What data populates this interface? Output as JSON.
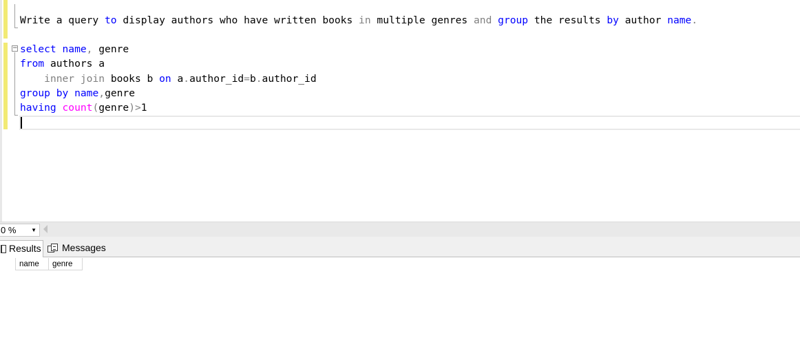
{
  "editor": {
    "comment_line": [
      {
        "t": "Write a query ",
        "c": ""
      },
      {
        "t": "to",
        "c": "kw"
      },
      {
        "t": " display authors who have written books ",
        "c": ""
      },
      {
        "t": "in",
        "c": "gr"
      },
      {
        "t": " multiple genres ",
        "c": ""
      },
      {
        "t": "and",
        "c": "gr"
      },
      {
        "t": " ",
        "c": ""
      },
      {
        "t": "group",
        "c": "kw"
      },
      {
        "t": " the results ",
        "c": ""
      },
      {
        "t": "by",
        "c": "kw"
      },
      {
        "t": " author ",
        "c": ""
      },
      {
        "t": "name",
        "c": "kw"
      },
      {
        "t": ".",
        "c": "gr"
      }
    ],
    "code_lines": [
      [
        {
          "t": "select",
          "c": "kw"
        },
        {
          "t": " ",
          "c": ""
        },
        {
          "t": "name",
          "c": "kw"
        },
        {
          "t": ",",
          "c": "gr"
        },
        {
          "t": " genre",
          "c": ""
        }
      ],
      [
        {
          "t": "from",
          "c": "kw"
        },
        {
          "t": " authors a",
          "c": ""
        }
      ],
      [
        {
          "t": "    ",
          "c": ""
        },
        {
          "t": "inner join",
          "c": "gr"
        },
        {
          "t": " books b ",
          "c": ""
        },
        {
          "t": "on",
          "c": "kw"
        },
        {
          "t": " a",
          "c": ""
        },
        {
          "t": ".",
          "c": "gr"
        },
        {
          "t": "author_id",
          "c": ""
        },
        {
          "t": "=",
          "c": "gr"
        },
        {
          "t": "b",
          "c": ""
        },
        {
          "t": ".",
          "c": "gr"
        },
        {
          "t": "author_id",
          "c": ""
        }
      ],
      [
        {
          "t": "group",
          "c": "kw"
        },
        {
          "t": " ",
          "c": ""
        },
        {
          "t": "by",
          "c": "kw"
        },
        {
          "t": " ",
          "c": ""
        },
        {
          "t": "name",
          "c": "kw"
        },
        {
          "t": ",",
          "c": "gr"
        },
        {
          "t": "genre",
          "c": ""
        }
      ],
      [
        {
          "t": "having",
          "c": "kw"
        },
        {
          "t": " ",
          "c": ""
        },
        {
          "t": "count",
          "c": "fn"
        },
        {
          "t": "(",
          "c": "gr"
        },
        {
          "t": "genre",
          "c": ""
        },
        {
          "t": ")>",
          "c": "gr"
        },
        {
          "t": "1",
          "c": ""
        }
      ]
    ],
    "collapse_glyph": "−"
  },
  "zoom": {
    "value": "0 %",
    "arrow": "▼"
  },
  "tabs": {
    "results_label": "Results",
    "messages_label": "Messages"
  },
  "grid": {
    "columns": [
      "name",
      "genre"
    ]
  },
  "colors": {
    "keyword": "#0000ff",
    "operator": "#808080",
    "function": "#ff00ff",
    "change_marker": "#f2ea74"
  }
}
